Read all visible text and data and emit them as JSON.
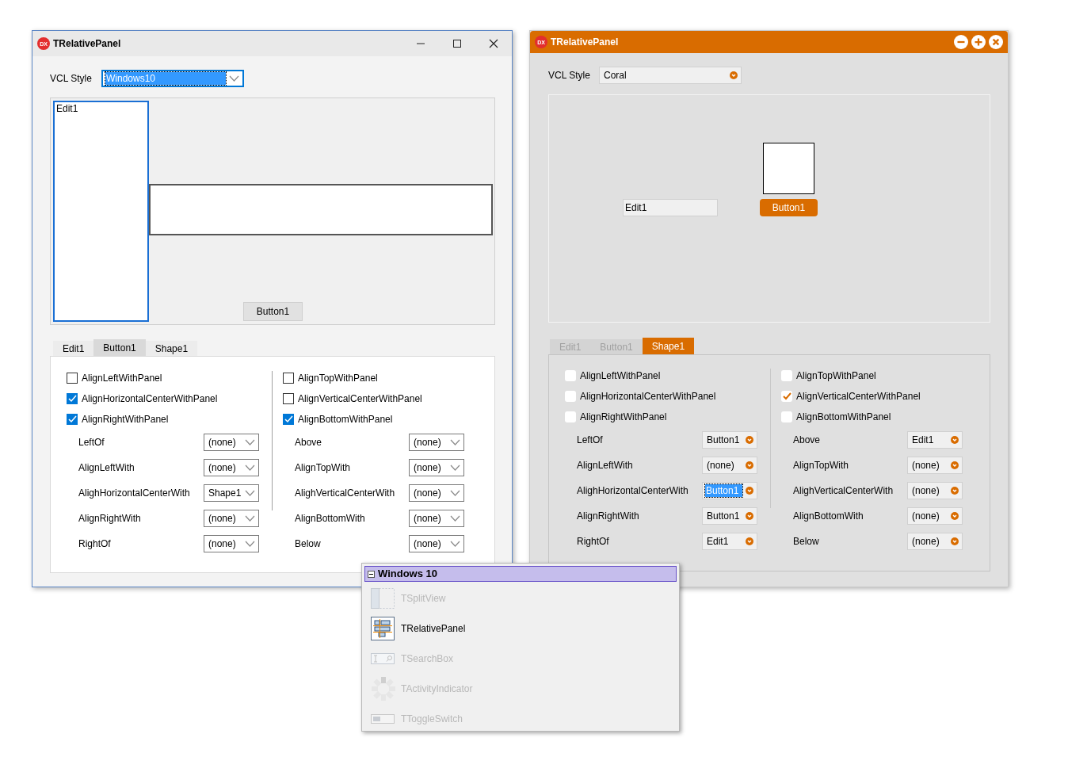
{
  "windows": [
    {
      "kind": "windows10",
      "logo": "DX",
      "title": "TRelativePanel",
      "vcl_style_label": "VCL Style",
      "vcl_style": {
        "value": "Windows10",
        "focused": true
      },
      "preview": {
        "edit": "Edit1",
        "button": "Button1"
      },
      "tabs": [
        {
          "label": "Edit1",
          "selected": false
        },
        {
          "label": "Button1",
          "selected": true
        },
        {
          "label": "Shape1",
          "selected": false
        }
      ],
      "columns": [
        {
          "checkboxes": [
            {
              "label": "AlignLeftWithPanel",
              "checked": false
            },
            {
              "label": "AlignHorizontalCenterWithPanel",
              "checked": true
            },
            {
              "label": "AlignRightWithPanel",
              "checked": true
            }
          ],
          "combos": [
            {
              "label": "LeftOf",
              "value": "(none)",
              "focused": false
            },
            {
              "label": "AlignLeftWith",
              "value": "(none)",
              "focused": false
            },
            {
              "label": "AlighHorizontalCenterWith",
              "value": "Shape1",
              "focused": false
            },
            {
              "label": "AlignRightWith",
              "value": "(none)",
              "focused": false
            },
            {
              "label": "RightOf",
              "value": "(none)",
              "focused": false
            }
          ]
        },
        {
          "checkboxes": [
            {
              "label": "AlignTopWithPanel",
              "checked": false
            },
            {
              "label": "AlignVerticalCenterWithPanel",
              "checked": false
            },
            {
              "label": "AlignBottomWithPanel",
              "checked": true
            }
          ],
          "combos": [
            {
              "label": "Above",
              "value": "(none)",
              "focused": false
            },
            {
              "label": "AlignTopWith",
              "value": "(none)",
              "focused": false
            },
            {
              "label": "AlighVerticalCenterWith",
              "value": "(none)",
              "focused": false
            },
            {
              "label": "AlignBottomWith",
              "value": "(none)",
              "focused": false
            },
            {
              "label": "Below",
              "value": "(none)",
              "focused": false
            }
          ]
        }
      ]
    },
    {
      "kind": "coral",
      "logo": "DX",
      "title": "TRelativePanel",
      "vcl_style_label": "VCL Style",
      "vcl_style": {
        "value": "Coral",
        "focused": false
      },
      "preview": {
        "edit": "Edit1",
        "button": "Button1"
      },
      "tabs": [
        {
          "label": "Edit1",
          "selected": false
        },
        {
          "label": "Button1",
          "selected": false
        },
        {
          "label": "Shape1",
          "selected": true
        }
      ],
      "columns": [
        {
          "checkboxes": [
            {
              "label": "AlignLeftWithPanel",
              "checked": false
            },
            {
              "label": "AlignHorizontalCenterWithPanel",
              "checked": false
            },
            {
              "label": "AlignRightWithPanel",
              "checked": false
            }
          ],
          "combos": [
            {
              "label": "LeftOf",
              "value": "Button1",
              "focused": false
            },
            {
              "label": "AlignLeftWith",
              "value": "(none)",
              "focused": false
            },
            {
              "label": "AlighHorizontalCenterWith",
              "value": "Button1",
              "focused": true
            },
            {
              "label": "AlignRightWith",
              "value": "Button1",
              "focused": false
            },
            {
              "label": "RightOf",
              "value": "Edit1",
              "focused": false
            }
          ]
        },
        {
          "checkboxes": [
            {
              "label": "AlignTopWithPanel",
              "checked": false
            },
            {
              "label": "AlignVerticalCenterWithPanel",
              "checked": true
            },
            {
              "label": "AlignBottomWithPanel",
              "checked": false
            }
          ],
          "combos": [
            {
              "label": "Above",
              "value": "Edit1",
              "focused": false
            },
            {
              "label": "AlignTopWith",
              "value": "(none)",
              "focused": false
            },
            {
              "label": "AlighVerticalCenterWith",
              "value": "(none)",
              "focused": false
            },
            {
              "label": "AlignBottomWith",
              "value": "(none)",
              "focused": false
            },
            {
              "label": "Below",
              "value": "(none)",
              "focused": false
            }
          ]
        }
      ]
    }
  ],
  "palette": {
    "category": "Windows 10",
    "expanded": true,
    "items": [
      {
        "kind": "splitview",
        "label": "TSplitView",
        "disabled": true
      },
      {
        "kind": "relativepanel",
        "label": "TRelativePanel",
        "disabled": false
      },
      {
        "kind": "searchbox",
        "label": "TSearchBox",
        "disabled": true
      },
      {
        "kind": "activity",
        "label": "TActivityIndicator",
        "disabled": true
      },
      {
        "kind": "toggleswitch",
        "label": "TToggleSwitch",
        "disabled": true
      }
    ]
  }
}
